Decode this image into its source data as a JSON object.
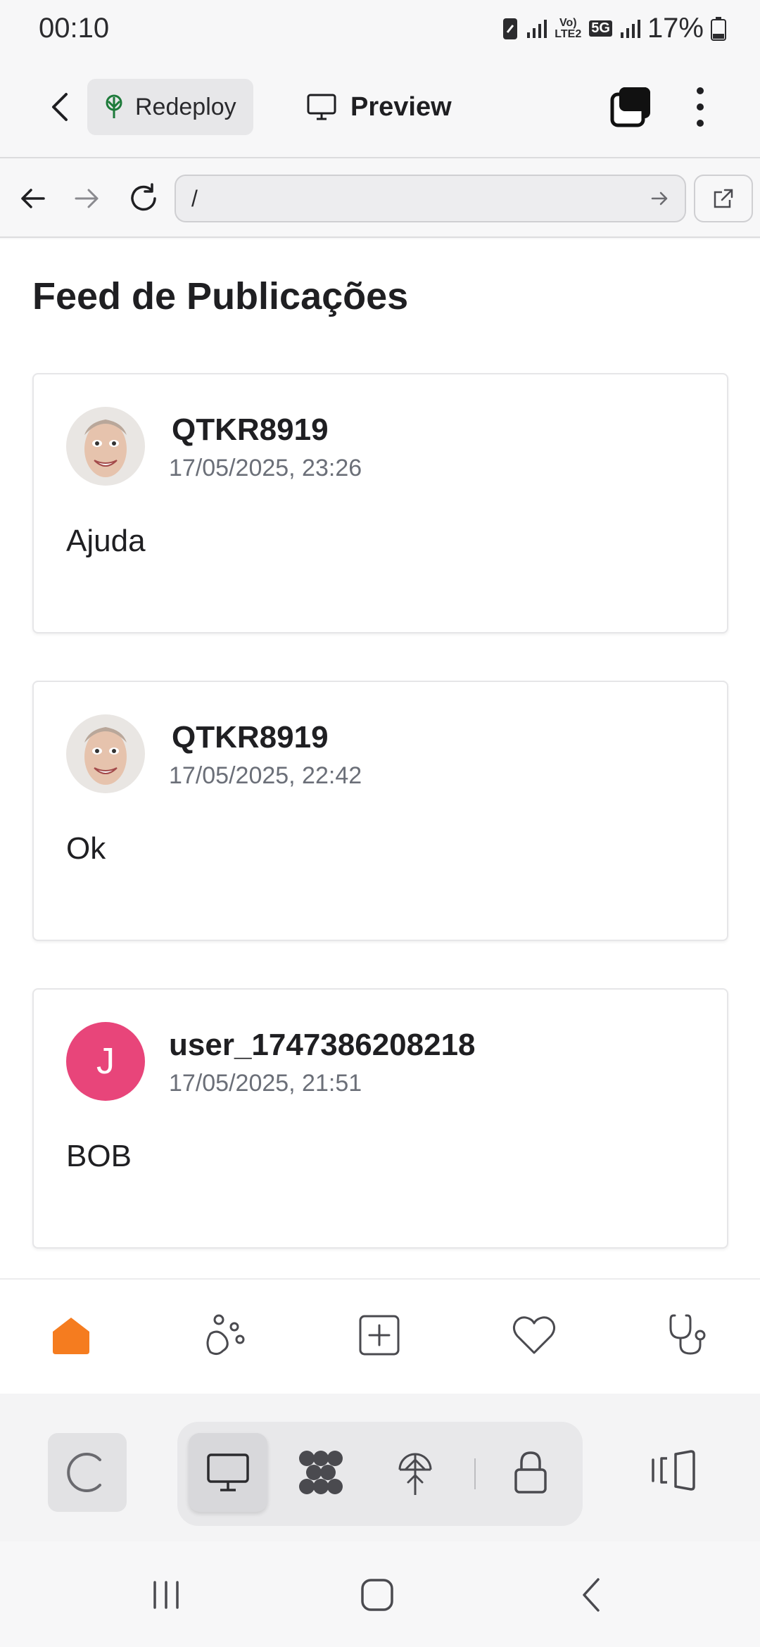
{
  "status": {
    "time": "00:10",
    "network": "Vo) LTE2",
    "network_5g": "5G",
    "battery": "17%"
  },
  "appbar": {
    "redeploy_label": "Redeploy",
    "preview_label": "Preview"
  },
  "browser": {
    "url": "/"
  },
  "feed": {
    "title": "Feed de Publicações",
    "posts": [
      {
        "user": "QTKR8919",
        "time": "17/05/2025, 23:26",
        "text": "Ajuda",
        "avatar": "photo"
      },
      {
        "user": "QTKR8919",
        "time": "17/05/2025, 22:42",
        "text": "Ok",
        "avatar": "photo"
      },
      {
        "user": "user_1747386208218",
        "time": "17/05/2025, 21:51",
        "text": "BOB",
        "avatar_letter": "J"
      }
    ]
  },
  "bottom_nav": {
    "items": [
      "home-icon",
      "paw-icon",
      "add-post-icon",
      "heart-icon",
      "stethoscope-icon"
    ],
    "active_color": "#f57c1f"
  },
  "colors": {
    "accent": "#f57c1f",
    "avatar_pink": "#e8457a"
  }
}
